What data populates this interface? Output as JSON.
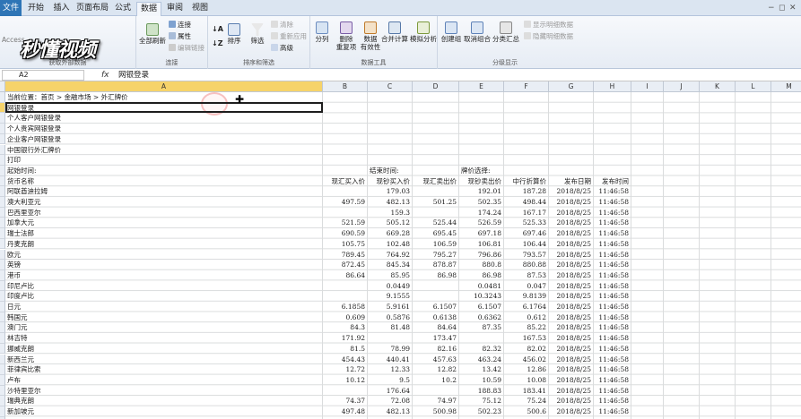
{
  "tabs": [
    "文件",
    "开始",
    "插入",
    "页面布局",
    "公式",
    "数据",
    "审阅",
    "视图"
  ],
  "active_tab": "数据",
  "watermark": "秒懂视频",
  "ribbon": {
    "external_data": {
      "label": "获取外部数据",
      "access": "Access"
    },
    "connections": {
      "label": "连接",
      "refresh_all": "全部刷新",
      "items": [
        "连接",
        "属性",
        "编辑链接"
      ]
    },
    "sort_filter": {
      "label": "排序和筛选",
      "sort": "排序",
      "filter": "筛选",
      "items": [
        "清除",
        "重新应用",
        "高级"
      ]
    },
    "data_tools": {
      "label": "数据工具",
      "buttons": [
        "分列",
        "删除\n重复项",
        "数据\n有效性",
        "合并计算",
        "模拟分析"
      ]
    },
    "outline": {
      "label": "分级显示",
      "buttons": [
        "创建组",
        "取消组合",
        "分类汇总"
      ],
      "items": [
        "显示明细数据",
        "隐藏明细数据"
      ]
    }
  },
  "namebox": "A2",
  "formula": "网银登录",
  "columns": [
    "A",
    "B",
    "C",
    "D",
    "E",
    "F",
    "G",
    "H",
    "I",
    "J",
    "K",
    "L",
    "M"
  ],
  "rows_col_a": [
    "当前位置：首页 > 金融市场 > 外汇牌价",
    "网银登录",
    "个人客户网银登录",
    "个人贵宾网银登录",
    "企业客户网银登录",
    "中国银行外汇牌价",
    "打印",
    "起始时间:",
    "货币名称"
  ],
  "header_row": {
    "c7": "结束时间:",
    "e7": "牌价选择:",
    "b8": "现汇买入价",
    "c8": "现钞买入价",
    "d8": "现汇卖出价",
    "e8": "现钞卖出价",
    "f8": "中行折算价",
    "g8": "发布日期",
    "h8": "发布时间"
  },
  "table": [
    [
      "阿联酋迪拉姆",
      "",
      "179.03",
      "",
      "192.01",
      "187.28",
      "2018/8/25",
      "11:46:58"
    ],
    [
      "澳大利亚元",
      "497.59",
      "482.13",
      "501.25",
      "502.35",
      "498.44",
      "2018/8/25",
      "11:46:58"
    ],
    [
      "巴西里亚尔",
      "",
      "159.3",
      "",
      "174.24",
      "167.17",
      "2018/8/25",
      "11:46:58"
    ],
    [
      "加拿大元",
      "521.59",
      "505.12",
      "525.44",
      "526.59",
      "525.33",
      "2018/8/25",
      "11:46:58"
    ],
    [
      "瑞士法郎",
      "690.59",
      "669.28",
      "695.45",
      "697.18",
      "697.46",
      "2018/8/25",
      "11:46:58"
    ],
    [
      "丹麦克朗",
      "105.75",
      "102.48",
      "106.59",
      "106.81",
      "106.44",
      "2018/8/25",
      "11:46:58"
    ],
    [
      "欧元",
      "789.45",
      "764.92",
      "795.27",
      "796.86",
      "793.57",
      "2018/8/25",
      "11:46:58"
    ],
    [
      "英镑",
      "872.45",
      "845.34",
      "878.87",
      "880.8",
      "880.88",
      "2018/8/25",
      "11:46:58"
    ],
    [
      "港币",
      "86.64",
      "85.95",
      "86.98",
      "86.98",
      "87.53",
      "2018/8/25",
      "11:46:58"
    ],
    [
      "印尼卢比",
      "",
      "0.0449",
      "",
      "0.0481",
      "0.047",
      "2018/8/25",
      "11:46:58"
    ],
    [
      "印度卢比",
      "",
      "9.1555",
      "",
      "10.3243",
      "9.8139",
      "2018/8/25",
      "11:46:58"
    ],
    [
      "日元",
      "6.1858",
      "5.9161",
      "6.1507",
      "6.1507",
      "6.1764",
      "2018/8/25",
      "11:46:58"
    ],
    [
      "韩国元",
      "0.609",
      "0.5876",
      "0.6138",
      "0.6362",
      "0.612",
      "2018/8/25",
      "11:46:58"
    ],
    [
      "澳门元",
      "84.3",
      "81.48",
      "84.64",
      "87.35",
      "85.22",
      "2018/8/25",
      "11:46:58"
    ],
    [
      "林吉特",
      "171.92",
      "",
      "173.47",
      "",
      "167.53",
      "2018/8/25",
      "11:46:58"
    ],
    [
      "挪威克朗",
      "81.5",
      "78.99",
      "82.16",
      "82.32",
      "82.02",
      "2018/8/25",
      "11:46:58"
    ],
    [
      "新西兰元",
      "454.43",
      "440.41",
      "457.63",
      "463.24",
      "456.02",
      "2018/8/25",
      "11:46:58"
    ],
    [
      "菲律宾比索",
      "12.72",
      "12.33",
      "12.82",
      "13.42",
      "12.86",
      "2018/8/25",
      "11:46:58"
    ],
    [
      "卢布",
      "10.12",
      "9.5",
      "10.2",
      "10.59",
      "10.08",
      "2018/8/25",
      "11:46:58"
    ],
    [
      "沙特里亚尔",
      "",
      "176.64",
      "",
      "188.83",
      "183.41",
      "2018/8/25",
      "11:46:58"
    ],
    [
      "瑞典克朗",
      "74.37",
      "72.08",
      "74.97",
      "75.12",
      "75.24",
      "2018/8/25",
      "11:46:58"
    ],
    [
      "新加坡元",
      "497.48",
      "482.13",
      "500.98",
      "502.23",
      "500.6",
      "2018/8/25",
      "11:46:58"
    ]
  ]
}
